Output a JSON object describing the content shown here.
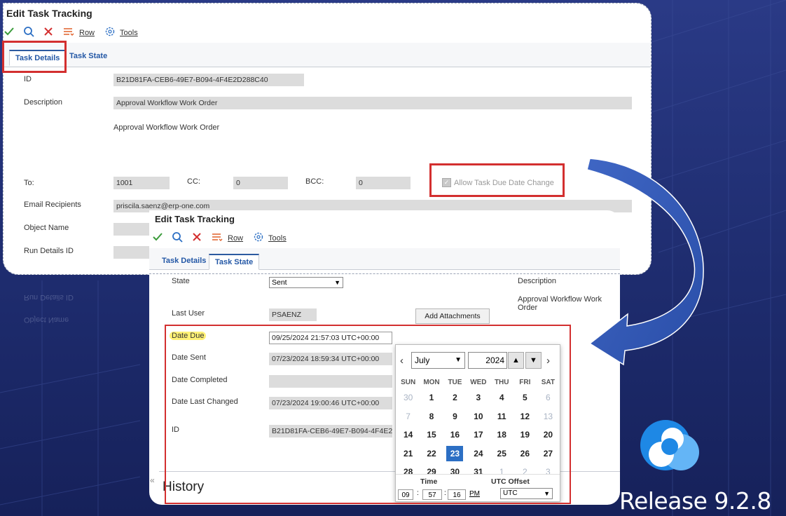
{
  "release": "Release 9.2.8",
  "window1": {
    "title": "Edit Task Tracking",
    "toolbar": {
      "row_label": "Row",
      "tools_label": "Tools"
    },
    "tabs": [
      {
        "label": "Task Details"
      },
      {
        "label": "Task State"
      }
    ],
    "fields": {
      "id_label": "ID",
      "id_value": "B21D81FA-CEB6-49E7-B094-4F4E2D288C40",
      "description_label": "Description",
      "description_value": "Approval Workflow Work Order",
      "description_text": "Approval Workflow Work Order",
      "to_label": "To:",
      "to_value": "1001",
      "cc_label": "CC:",
      "cc_value": "0",
      "bcc_label": "BCC:",
      "bcc_value": "0",
      "allow_change_label": "Allow Task Due Date Change",
      "email_label": "Email Recipients",
      "email_value": "priscila.saenz@erp-one.com",
      "object_name_label": "Object Name",
      "run_details_label": "Run Details ID"
    },
    "reflection": {
      "run_details": "Run Details ID",
      "object_name": "Object Name"
    }
  },
  "window2": {
    "title": "Edit Task Tracking",
    "toolbar": {
      "row_label": "Row",
      "tools_label": "Tools"
    },
    "tabs": [
      {
        "label": "Task Details"
      },
      {
        "label": "Task State"
      }
    ],
    "fields": {
      "state_label": "State",
      "state_value": "Sent",
      "description_label": "Description",
      "description_value": "Approval Workflow Work Order",
      "last_user_label": "Last User",
      "last_user_value": "PSAENZ",
      "add_attachments_label": "Add Attachments",
      "date_due_label": "Date Due",
      "date_due_value": "09/25/2024 21:57:03 UTC+00:00",
      "date_sent_label": "Date Sent",
      "date_sent_value": "07/23/2024 18:59:34 UTC+00:00",
      "date_completed_label": "Date Completed",
      "date_last_changed_label": "Date Last Changed",
      "date_last_changed_value": "07/23/2024 19:00:46 UTC+00:00",
      "id_label": "ID",
      "id_value": "B21D81FA-CEB6-49E7-B094-4F4E2D"
    },
    "history_label": "History",
    "calendar": {
      "month": "July",
      "year": "2024",
      "weekdays": [
        "SUN",
        "MON",
        "TUE",
        "WED",
        "THU",
        "FRI",
        "SAT"
      ],
      "weeks": [
        [
          {
            "d": "30",
            "m": true
          },
          {
            "d": "1"
          },
          {
            "d": "2"
          },
          {
            "d": "3"
          },
          {
            "d": "4"
          },
          {
            "d": "5"
          },
          {
            "d": "6",
            "m": true
          }
        ],
        [
          {
            "d": "7",
            "m": true
          },
          {
            "d": "8"
          },
          {
            "d": "9"
          },
          {
            "d": "10"
          },
          {
            "d": "11"
          },
          {
            "d": "12"
          },
          {
            "d": "13",
            "m": true
          }
        ],
        [
          {
            "d": "14"
          },
          {
            "d": "15"
          },
          {
            "d": "16"
          },
          {
            "d": "17"
          },
          {
            "d": "18"
          },
          {
            "d": "19"
          },
          {
            "d": "20"
          }
        ],
        [
          {
            "d": "21"
          },
          {
            "d": "22"
          },
          {
            "d": "23",
            "s": true
          },
          {
            "d": "24"
          },
          {
            "d": "25"
          },
          {
            "d": "26"
          },
          {
            "d": "27"
          }
        ],
        [
          {
            "d": "28"
          },
          {
            "d": "29"
          },
          {
            "d": "30"
          },
          {
            "d": "31"
          },
          {
            "d": "1",
            "m": true
          },
          {
            "d": "2",
            "m": true
          },
          {
            "d": "3",
            "m": true
          }
        ]
      ],
      "time_label": "Time",
      "utc_offset_label": "UTC Offset",
      "hour": "09",
      "minute": "57",
      "second": "16",
      "ampm": "PM",
      "utc_value": "UTC"
    }
  },
  "colors": {
    "accent": "#2c5aa0",
    "highlight_red": "#d32f2f",
    "date_due_highlight": "#fff176"
  }
}
